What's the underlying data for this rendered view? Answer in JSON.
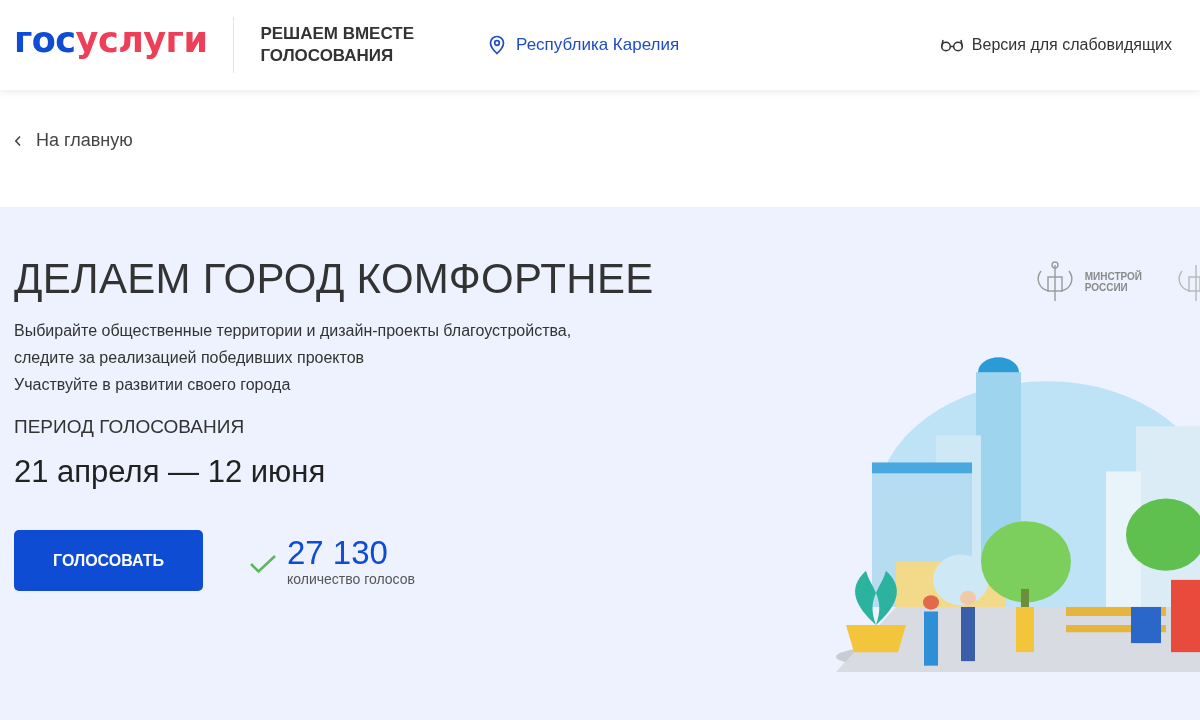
{
  "header": {
    "logo": {
      "first": "гос",
      "second": "услуги"
    },
    "project_title": [
      "РЕШАЕМ ВМЕСТЕ",
      "ГОЛОСОВАНИЯ"
    ],
    "region": "Республика Карелия",
    "accessibility": "Версия для слабовидящих"
  },
  "back_link": "На главную",
  "hero": {
    "title": "ДЕЛАЕМ ГОРОД КОМФОРТНЕЕ",
    "description": [
      "Выбирайте общественные территории и дизайн-проекты благоустройства,",
      "следите за реализацией победивших проектов",
      "Участвуйте в развитии своего города"
    ],
    "period_label": "ПЕРИОД ГОЛОСОВАНИЯ",
    "period": "21 апреля — 12 июня",
    "vote_button": "ГОЛОСОВАТЬ",
    "votes_count": "27 130",
    "votes_label": "количество голосов",
    "partner": [
      "МИНСТРОЙ",
      "РОССИИ"
    ]
  }
}
